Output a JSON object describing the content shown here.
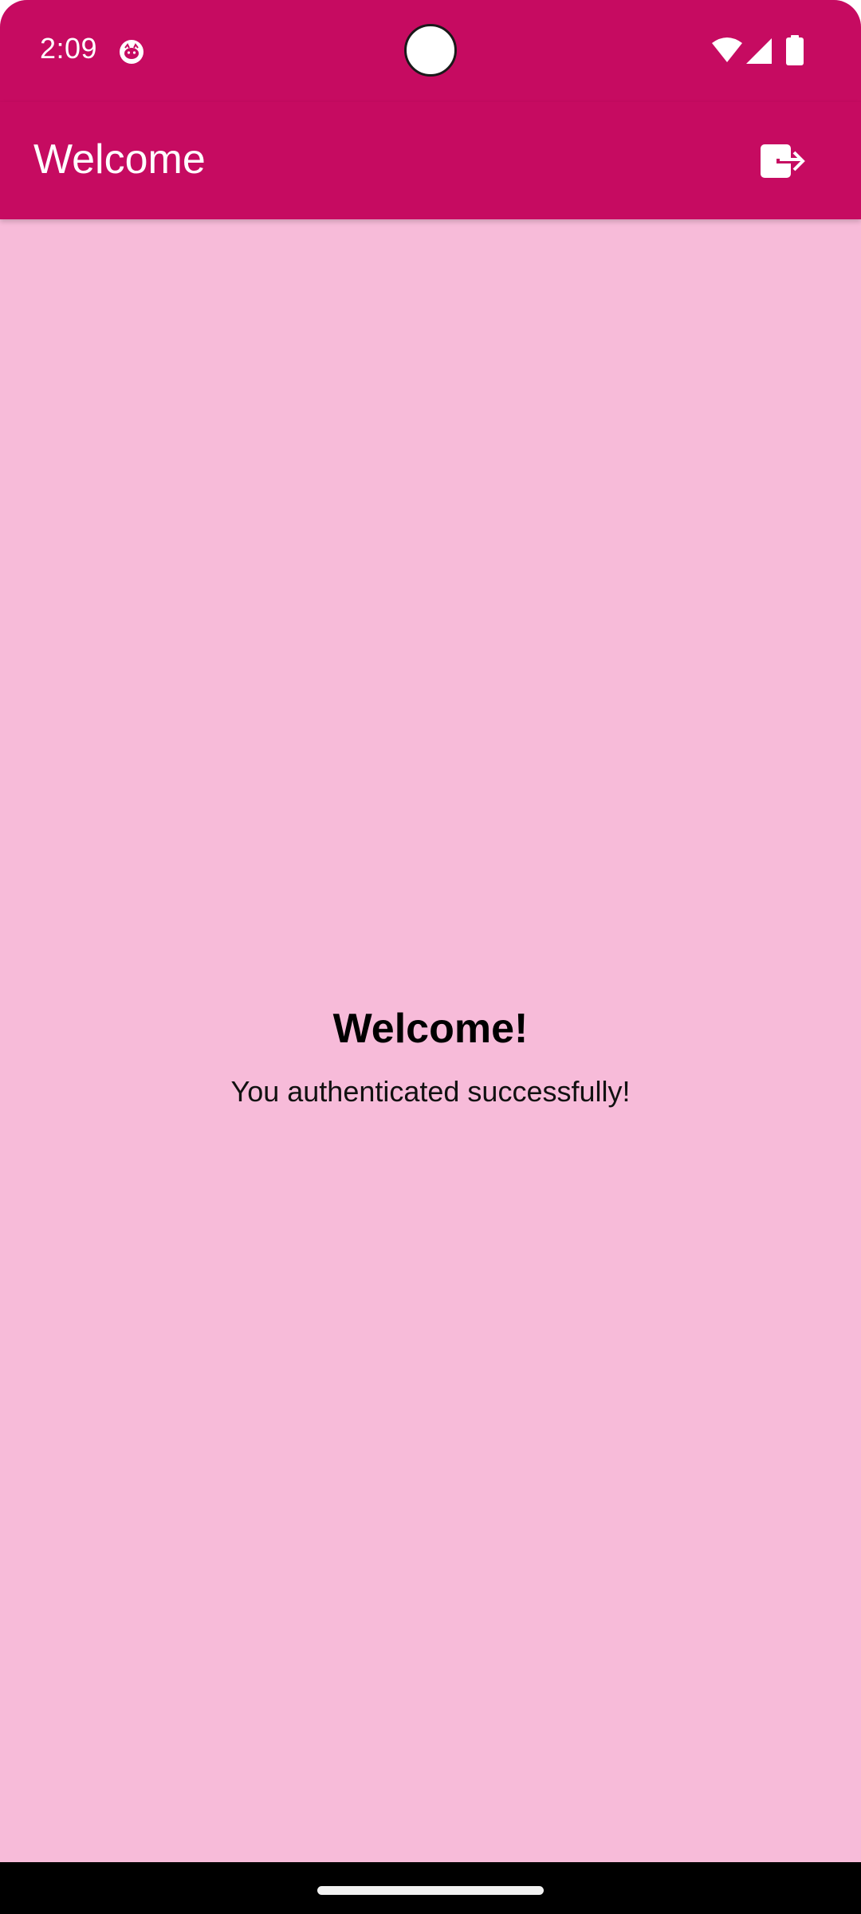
{
  "status_bar": {
    "time": "2:09",
    "icons": [
      "notification-icon",
      "wifi-icon",
      "cellular-signal-icon",
      "battery-icon"
    ]
  },
  "app_bar": {
    "title": "Welcome",
    "action_icon": "logout-icon"
  },
  "content": {
    "heading": "Welcome!",
    "message": "You authenticated successfully!"
  },
  "colors": {
    "primary": "#c60b61",
    "background": "#f7bbd9",
    "nav_bar": "#000000"
  }
}
